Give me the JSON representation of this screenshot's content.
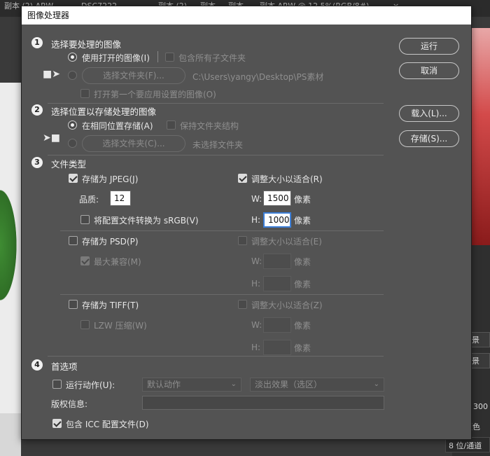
{
  "background": {
    "tabs": [
      "副本 (2).ARW",
      "DSC7222",
      "副本 (2)",
      "副本",
      "副本",
      "副本.ARW @ 12.5%(RGB/8#)",
      "×"
    ],
    "right_panel": [
      "景",
      "景",
      "300",
      "颜色",
      "8 位/通道"
    ]
  },
  "dialog": {
    "title": "图像处理器",
    "buttons": {
      "run": "运行",
      "cancel": "取消",
      "load": "载入(L)...",
      "save": "存储(S)..."
    },
    "section1": {
      "number": "1",
      "heading": "选择要处理的图像",
      "use_open_images": "使用打开的图像(I)",
      "include_subfolders": "包含所有子文件夹",
      "select_folder_button": "选择文件夹(F)...",
      "folder_path": "C:\\Users\\yangy\\Desktop\\PS素材",
      "open_first_image": "打开第一个要应用设置的图像(O)"
    },
    "section2": {
      "number": "2",
      "heading": "选择位置以存储处理的图像",
      "save_same_location": "在相同位置存储(A)",
      "keep_folder_structure": "保持文件夹结构",
      "select_folder_button": "选择文件夹(C)...",
      "no_folder": "未选择文件夹"
    },
    "section3": {
      "number": "3",
      "heading": "文件类型",
      "jpeg": {
        "save_as": "存储为 JPEG(J)",
        "resize": "调整大小以适合(R)",
        "quality_label": "品质:",
        "quality_value": "12",
        "w_label": "W:",
        "w_value": "1500",
        "h_label": "H:",
        "h_value": "1000",
        "unit": "像素",
        "convert_srgb": "将配置文件转换为 sRGB(V)"
      },
      "psd": {
        "save_as": "存储为 PSD(P)",
        "resize": "调整大小以适合(E)",
        "max_compat": "最大兼容(M)",
        "w_label": "W:",
        "h_label": "H:",
        "unit": "像素"
      },
      "tiff": {
        "save_as": "存储为 TIFF(T)",
        "resize": "调整大小以适合(Z)",
        "lzw": "LZW 压缩(W)",
        "w_label": "W:",
        "h_label": "H:",
        "unit": "像素"
      }
    },
    "section4": {
      "number": "4",
      "heading": "首选项",
      "run_action": "运行动作(U):",
      "action_set": "默认动作",
      "action": "淡出效果（选区）",
      "copyright_label": "版权信息:",
      "copyright_value": "",
      "include_icc": "包含 ICC 配置文件(D)"
    }
  }
}
